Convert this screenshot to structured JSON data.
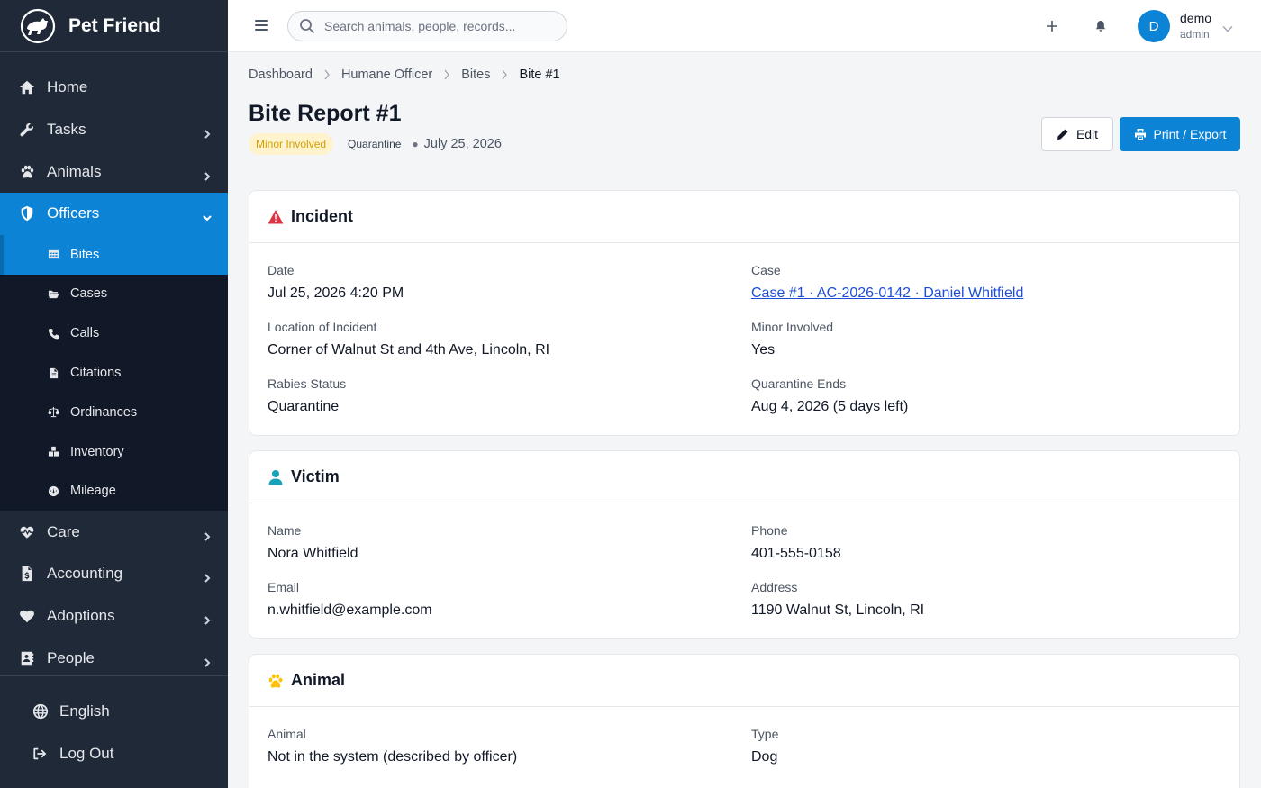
{
  "brand": {
    "name": "Pet Friend"
  },
  "sidebar": {
    "items": [
      {
        "label": "Home",
        "icon": "home-icon"
      },
      {
        "label": "Tasks",
        "icon": "wrench-icon"
      },
      {
        "label": "Animals",
        "icon": "paw-icon"
      },
      {
        "label": "Officers",
        "icon": "shield-icon"
      },
      {
        "label": "Care",
        "icon": "heartbeat-icon"
      },
      {
        "label": "Accounting",
        "icon": "invoice-icon"
      },
      {
        "label": "Adoptions",
        "icon": "heart-icon"
      },
      {
        "label": "People",
        "icon": "contact-icon"
      }
    ],
    "officers_sub": [
      {
        "label": "Bites",
        "icon": "table-icon"
      },
      {
        "label": "Cases",
        "icon": "folder-icon"
      },
      {
        "label": "Calls",
        "icon": "phone-icon"
      },
      {
        "label": "Citations",
        "icon": "file-icon"
      },
      {
        "label": "Ordinances",
        "icon": "scale-icon"
      },
      {
        "label": "Inventory",
        "icon": "boxes-icon"
      },
      {
        "label": "Mileage",
        "icon": "gauge-icon"
      }
    ],
    "bottom": [
      {
        "label": "English",
        "icon": "globe-icon"
      },
      {
        "label": "Log Out",
        "icon": "logout-icon"
      }
    ]
  },
  "topbar": {
    "search_placeholder": "Search animals, people, records...",
    "avatar_initial": "D",
    "user_name": "demo",
    "user_role": "admin"
  },
  "breadcrumb": [
    "Dashboard",
    "Humane Officer",
    "Bites",
    "Bite #1"
  ],
  "page": {
    "title": "Bite Report #1",
    "badge_minor": "Minor Involved",
    "badge_rabies": "Quarantine",
    "date": "July 25, 2026",
    "edit_label": "Edit",
    "print_label": "Print / Export"
  },
  "incident": {
    "title": "Incident",
    "date_label": "Date",
    "date_value": "Jul 25, 2026 4:20 PM",
    "case_label": "Case",
    "case_value": "Case #1 · AC-2026-0142 · Daniel Whitfield",
    "location_label": "Location of Incident",
    "location_value": "Corner of Walnut St and 4th Ave, Lincoln, RI",
    "minor_label": "Minor Involved",
    "minor_value": "Yes",
    "rabies_label": "Rabies Status",
    "rabies_value": "Quarantine",
    "quarantine_label": "Quarantine Ends",
    "quarantine_value": "Aug 4, 2026 (5 days left)"
  },
  "victim": {
    "title": "Victim",
    "name_label": "Name",
    "name_value": "Nora Whitfield",
    "phone_label": "Phone",
    "phone_value": "401-555-0158",
    "email_label": "Email",
    "email_value": "n.whitfield@example.com",
    "address_label": "Address",
    "address_value": "1190 Walnut St, Lincoln, RI"
  },
  "animal": {
    "title": "Animal",
    "animal_label": "Animal",
    "animal_value": "Not in the system (described by officer)",
    "type_label": "Type",
    "type_value": "Dog"
  },
  "colors": {
    "sidebar_bg": "#1f2937",
    "accent": "#0d83d6",
    "warning_icon": "#dc3545",
    "victim_icon": "#17a2b8",
    "animal_icon": "#ffc107"
  }
}
